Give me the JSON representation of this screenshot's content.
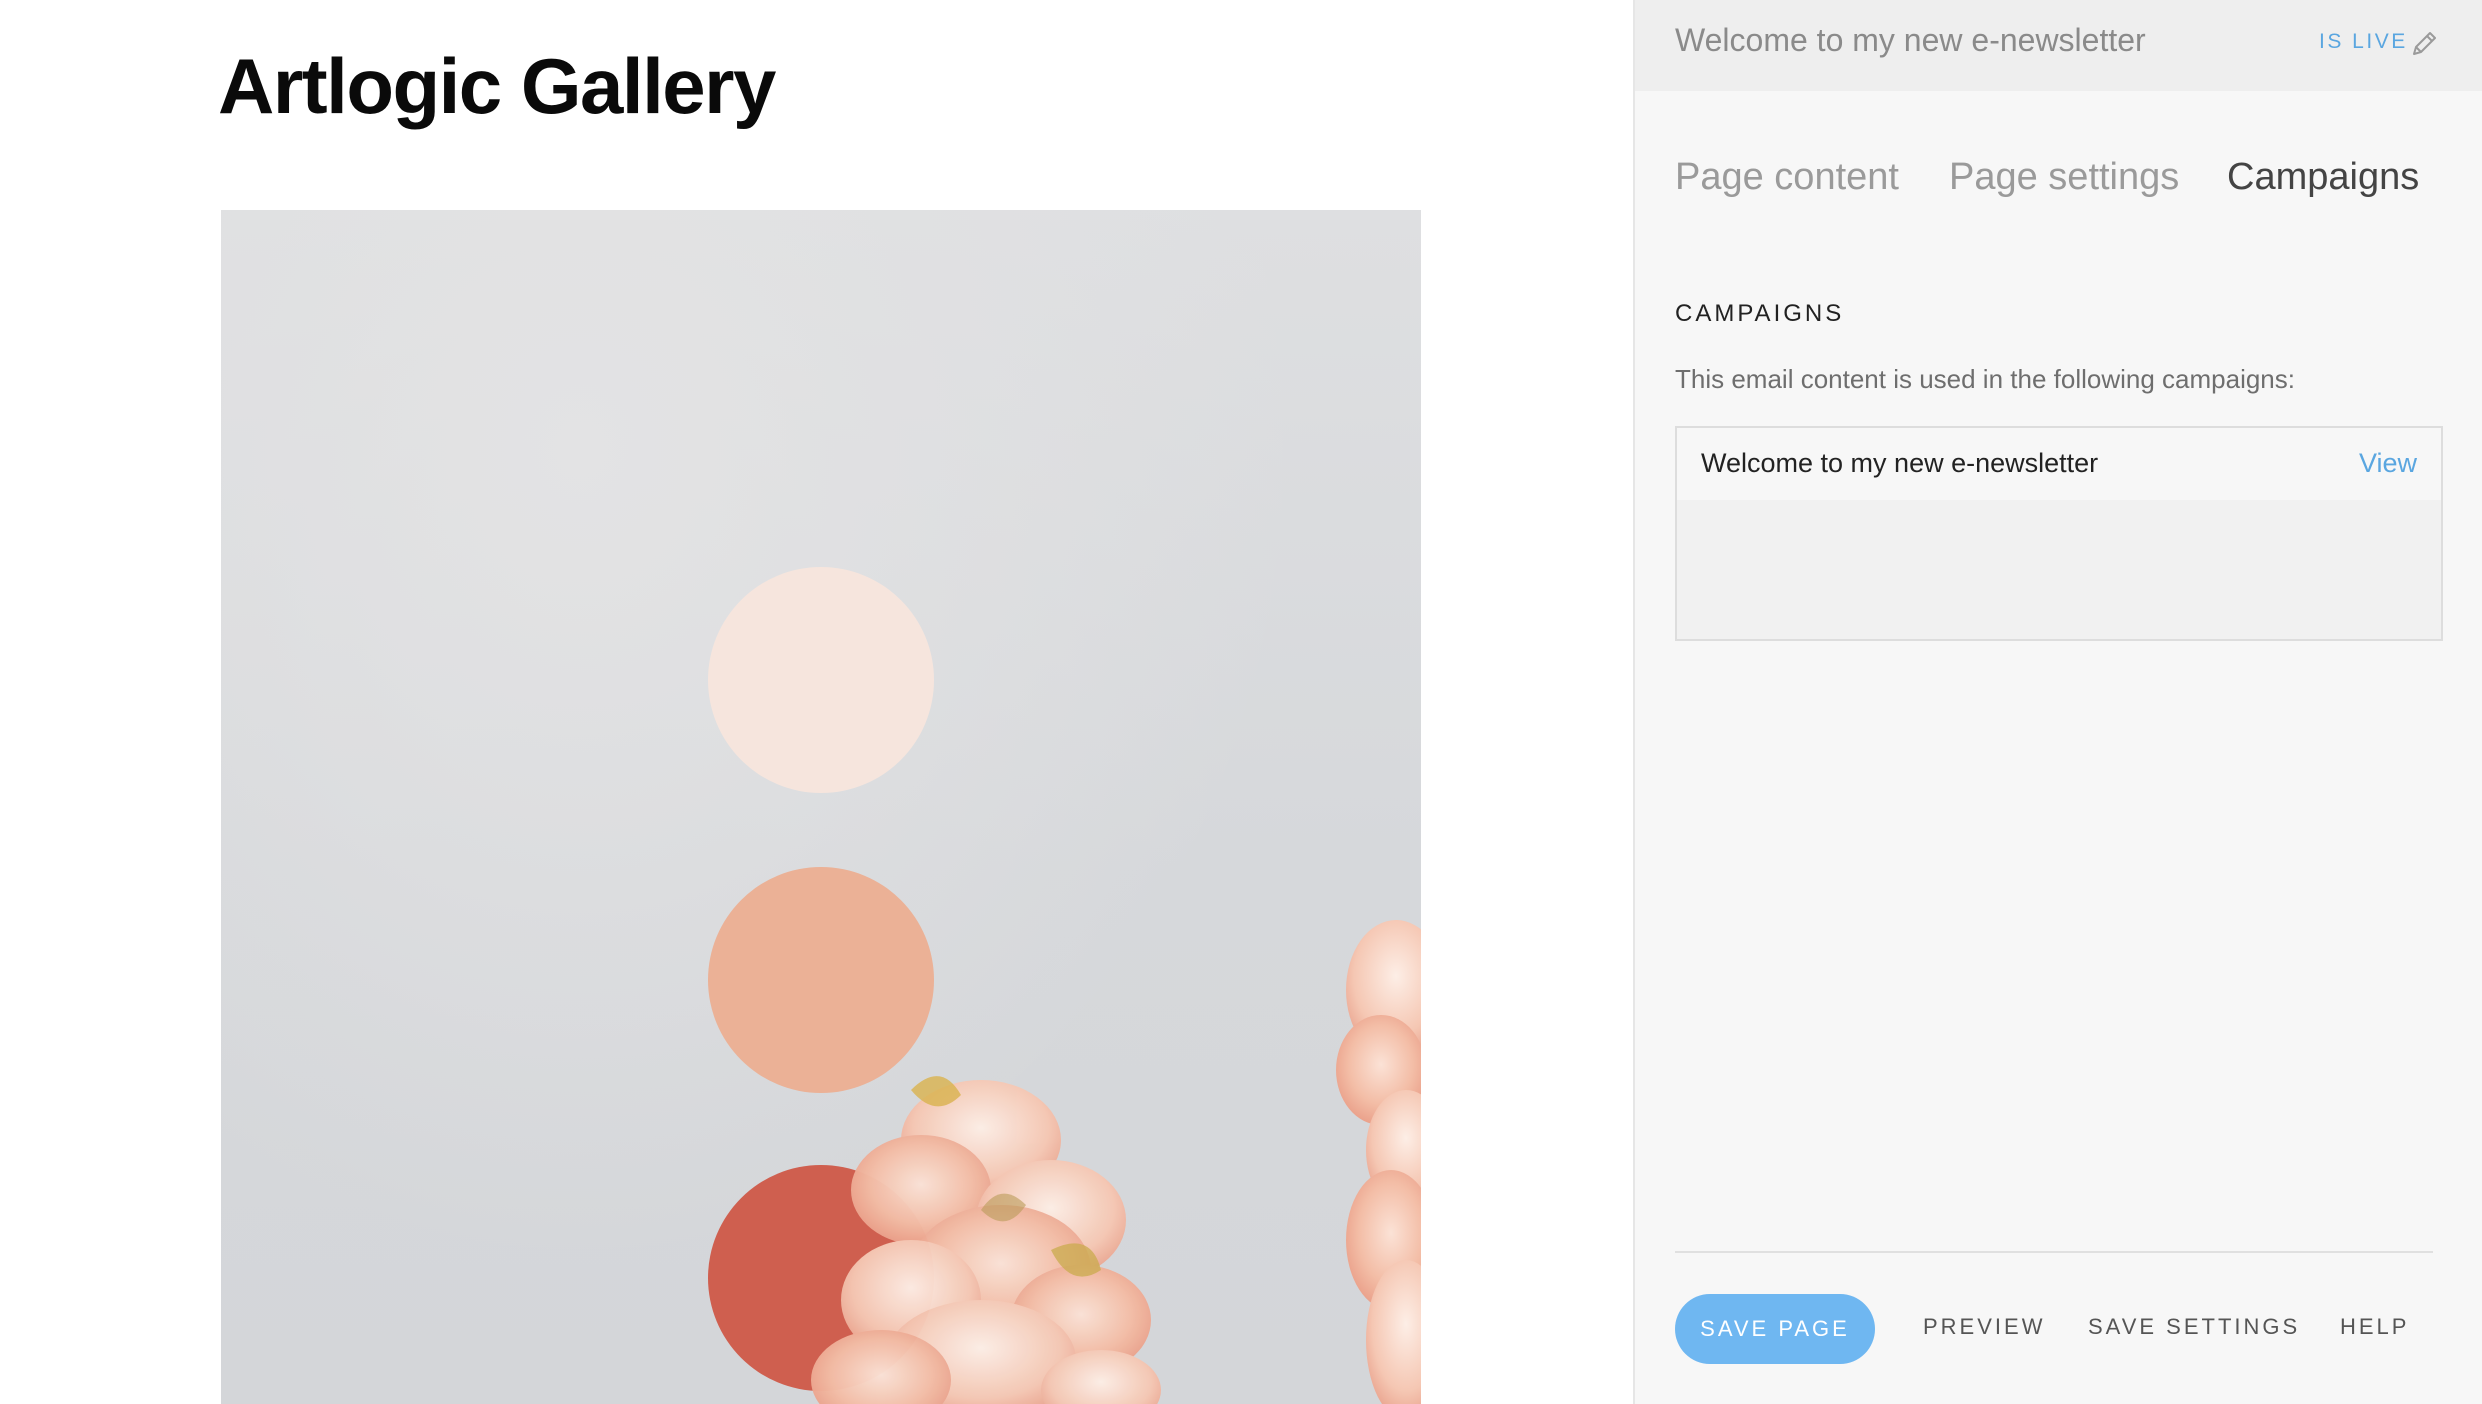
{
  "preview": {
    "gallery_title": "Artlogic Gallery",
    "artwork": {
      "description_icon": "artwork-image",
      "circle_colors": [
        "#f6e5dd",
        "#ebb196",
        "#cf5f4f"
      ],
      "background_color": "#d9dadc"
    }
  },
  "panel": {
    "header": {
      "document_title": "Welcome to my new e-newsletter",
      "live_status": "IS LIVE",
      "edit_icon": "pencil-icon"
    },
    "tabs": [
      {
        "label": "Page content",
        "active": false
      },
      {
        "label": "Page settings",
        "active": false
      },
      {
        "label": "Campaigns",
        "active": true
      }
    ],
    "campaigns": {
      "heading": "CAMPAIGNS",
      "description": "This email content is used in the following campaigns:",
      "items": [
        {
          "name": "Welcome to my new e-newsletter",
          "action": "View"
        }
      ]
    },
    "footer": {
      "save_page": "SAVE PAGE",
      "preview": "PREVIEW",
      "save_settings": "SAVE SETTINGS",
      "help": "HELP"
    },
    "colors": {
      "accent": "#5aa6e0",
      "button": "#6fb7f1"
    }
  }
}
